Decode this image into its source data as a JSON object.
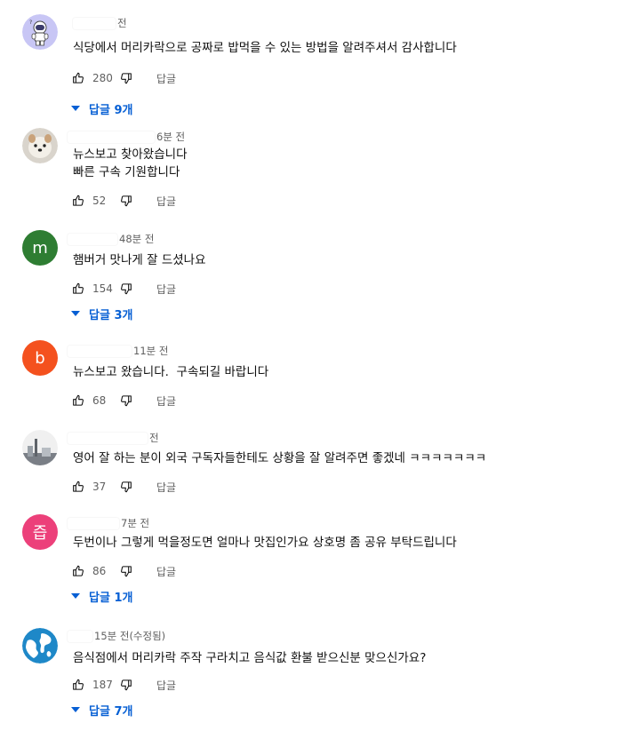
{
  "comments": [
    {
      "time": "전",
      "text": "식당에서 머리카락으로 공짜로 밥먹을 수 있는 방법을 알려주셔서 감사합니다",
      "likes": "280",
      "reply_label": "답글",
      "replies_label": "답글 9개",
      "avatar": {
        "kind": "astronaut",
        "bg": "#c8c6f5"
      }
    },
    {
      "time": "6분 전",
      "text": "뉴스보고 찾아왔습니다\n빠른 구속 기원합니다",
      "likes": "52",
      "reply_label": "답글",
      "avatar": {
        "kind": "dog",
        "bg": "#d9d4cc"
      }
    },
    {
      "time": "48분 전",
      "text": "햄버거 맛나게 잘 드셨나요",
      "likes": "154",
      "reply_label": "답글",
      "replies_label": "답글 3개",
      "avatar": {
        "kind": "letter",
        "letter": "m",
        "bg": "#2e7d32"
      }
    },
    {
      "time": "11분 전",
      "text": "뉴스보고 왔습니다.  구속되길 바랍니다",
      "likes": "68",
      "reply_label": "답글",
      "avatar": {
        "kind": "letter",
        "letter": "b",
        "bg": "#f4511e"
      }
    },
    {
      "time": "전",
      "text": "영어 잘 하는 분이 외국 구독자들한테도 상황을 잘 알려주면 좋겠네 ㅋㅋㅋㅋㅋㅋㅋ",
      "likes": "37",
      "reply_label": "답글",
      "avatar": {
        "kind": "photo",
        "bg": "#e6e6e6"
      }
    },
    {
      "time": "7분 전",
      "text": "두번이나 그렇게 먹을정도면 얼마나 맛집인가요 상호명 좀 공유 부탁드립니다",
      "likes": "86",
      "reply_label": "답글",
      "replies_label": "답글 1개",
      "avatar": {
        "kind": "letter",
        "letter": "즙",
        "bg": "#ec407a"
      }
    },
    {
      "time": "15분 전(수정됨)",
      "text": "음식점에서 머리카락 주작 구라치고 음식값 환불 받으신분 맞으신가요?",
      "likes": "187",
      "reply_label": "답글",
      "replies_label": "답글 7개",
      "avatar": {
        "kind": "globe",
        "bg": "#1e88c8"
      }
    }
  ],
  "colors": {
    "link": "#065fd4",
    "muted": "#606060",
    "text": "#0f0f0f"
  },
  "icons": {
    "like": "thumb-up-icon",
    "dislike": "thumb-down-icon",
    "expand": "caret-down-icon"
  }
}
